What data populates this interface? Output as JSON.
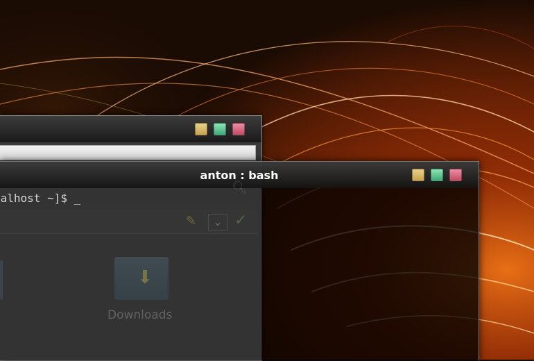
{
  "terminal": {
    "title": "anton : bash",
    "prompt_line": "calhost ~]$ _"
  },
  "file_manager": {
    "folders": [
      {
        "label": "Downloads",
        "icon": "folder-download-icon"
      }
    ]
  },
  "colors": {
    "wallpaper_base": "#1a0d05",
    "wallpaper_glow": "#ff6a10",
    "minimize_button": "#d9b865",
    "maximize_button": "#5cc890",
    "close_button": "#d76a82"
  }
}
